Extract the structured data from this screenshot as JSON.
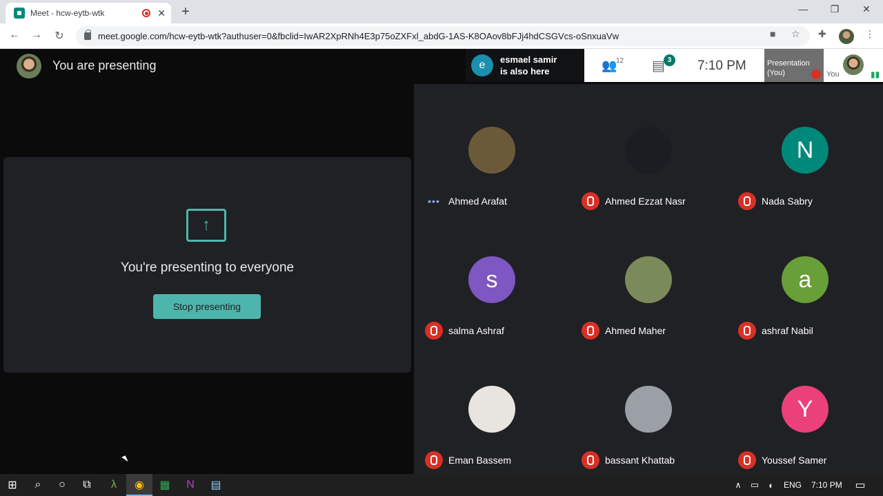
{
  "browser": {
    "tab_title": "Meet - hcw-eytb-wtk",
    "tab_close": "✕",
    "new_tab": "+",
    "url": "meet.google.com/hcw-eytb-wtk?authuser=0&fbclid=IwAR2XpRNh4E3p75oZXFxl_abdG-1AS-K8OAov8bFJj4hdCSGVcs-oSnxuaVw",
    "minimize": "—",
    "maximize": "❐",
    "close": "✕"
  },
  "meet": {
    "presenting_title": "You are presenting",
    "notification": {
      "avatar_letter": "e",
      "line1": "esmael samir",
      "line2": "is also here"
    },
    "participant_count": "12",
    "chat_badge": "3",
    "clock": "7:10 PM",
    "presentation_tile": {
      "line1": "Presentation",
      "line2": "(You)"
    },
    "you_tile_label": "You",
    "present_card": {
      "message": "You're presenting to everyone",
      "stop_button": "Stop presenting"
    },
    "participants": [
      {
        "name": "Ahmed Arafat",
        "letter": "",
        "color": "#6b5a3a",
        "status": "speaking"
      },
      {
        "name": "Ahmed Ezzat Nasr",
        "letter": "",
        "color": "#1b1d22",
        "status": "muted"
      },
      {
        "name": "Nada Sabry",
        "letter": "N",
        "color": "#00897b",
        "status": "muted"
      },
      {
        "name": "salma Ashraf",
        "letter": "s",
        "color": "#7e57c2",
        "status": "muted"
      },
      {
        "name": "Ahmed Maher",
        "letter": "",
        "color": "#7a8a5a",
        "status": "muted"
      },
      {
        "name": "ashraf Nabil",
        "letter": "a",
        "color": "#689f38",
        "status": "muted"
      },
      {
        "name": "Eman Bassem",
        "letter": "",
        "color": "#e8e4df",
        "status": "muted"
      },
      {
        "name": "bassant Khattab",
        "letter": "",
        "color": "#9aa0a6",
        "status": "muted"
      },
      {
        "name": "Youssef Samer",
        "letter": "Y",
        "color": "#ec407a",
        "status": "muted"
      }
    ]
  },
  "taskbar": {
    "language": "ENG",
    "time": "7:10 PM"
  }
}
